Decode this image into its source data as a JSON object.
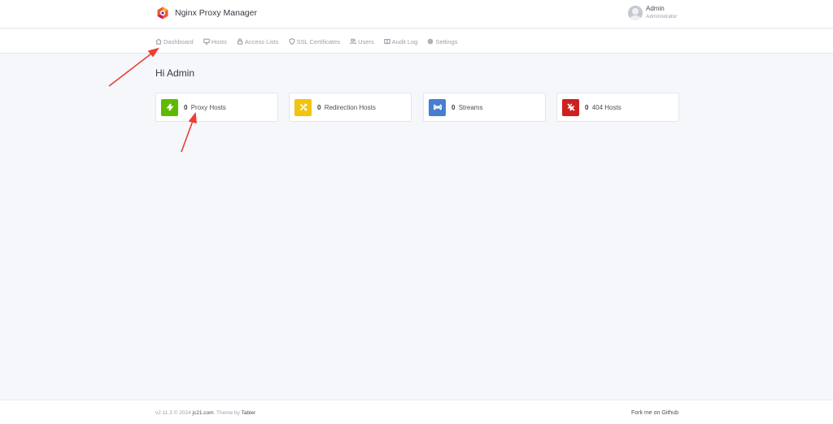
{
  "header": {
    "app_name": "Nginx Proxy Manager",
    "user_name": "Admin",
    "user_role": "Administrator"
  },
  "nav": {
    "items": [
      {
        "label": "Dashboard",
        "icon": "home-icon"
      },
      {
        "label": "Hosts",
        "icon": "monitor-icon"
      },
      {
        "label": "Access Lists",
        "icon": "lock-icon"
      },
      {
        "label": "SSL Certificates",
        "icon": "shield-icon"
      },
      {
        "label": "Users",
        "icon": "users-icon"
      },
      {
        "label": "Audit Log",
        "icon": "book-open-icon"
      },
      {
        "label": "Settings",
        "icon": "gear-icon"
      }
    ]
  },
  "main": {
    "greeting": "Hi Admin",
    "cards": [
      {
        "count": "0",
        "label": "Proxy Hosts",
        "color": "#5eba00",
        "icon": "zap-icon"
      },
      {
        "count": "0",
        "label": "Redirection Hosts",
        "color": "#f1c40f",
        "icon": "shuffle-icon"
      },
      {
        "count": "0",
        "label": "Streams",
        "color": "#467fcf",
        "icon": "radio-icon"
      },
      {
        "count": "0",
        "label": "404 Hosts",
        "color": "#cd201f",
        "icon": "zap-off-icon"
      }
    ]
  },
  "footer": {
    "version": "v2.11.3 © 2024 ",
    "company": "jc21.com",
    "theme_by": ". Theme by ",
    "theme": "Tabler",
    "github": "Fork me on Github"
  },
  "annotation_color": "#f03c32"
}
